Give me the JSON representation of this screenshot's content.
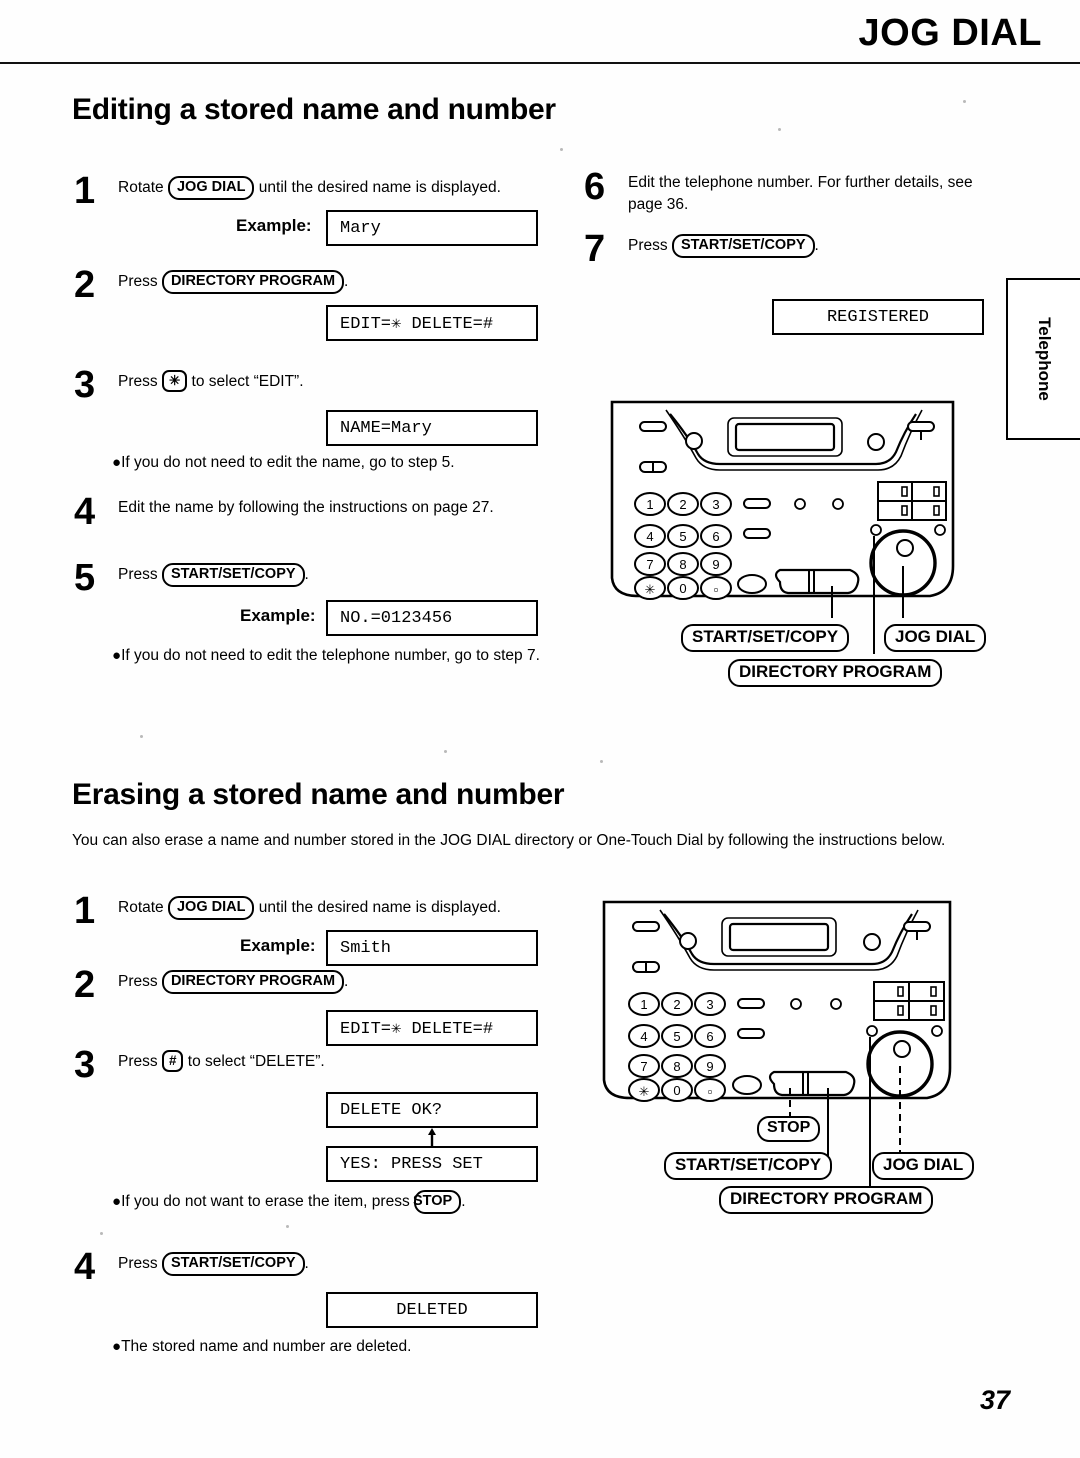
{
  "header": {
    "title": "JOG DIAL"
  },
  "page_number": "37",
  "side_tab": {
    "label": "Telephone"
  },
  "sections": [
    {
      "id": "editing",
      "title": "Editing a stored name and number",
      "steps": [
        {
          "num": "1",
          "text_before": "Rotate ",
          "key": "JOG DIAL",
          "text_after": " until the desired name is displayed.",
          "example_label": "Example:",
          "lcd": "Mary"
        },
        {
          "num": "2",
          "text_before": "Press ",
          "key": "DIRECTORY PROGRAM",
          "text_after": ".",
          "lcd": "EDIT=✳ DELETE=#"
        },
        {
          "num": "3",
          "text_before": "Press ",
          "key": "✳",
          "text_after": " to select “EDIT”.",
          "lcd": "NAME=Mary"
        },
        {
          "num": "4",
          "text_before": "Edit the name by following the instructions on page 27.",
          "key": "",
          "text_after": ""
        },
        {
          "num": "5",
          "text_before": "Press ",
          "key": "START/SET/COPY",
          "text_after": ".",
          "example_label": "Example:",
          "lcd": "NO.=0123456"
        },
        {
          "num": "6",
          "text_before": "Edit the telephone number. For further details, see page 36.",
          "key": "",
          "text_after": ""
        },
        {
          "num": "7",
          "text_before": "Press ",
          "key": "START/SET/COPY",
          "text_after": ".",
          "lcd": "REGISTERED"
        }
      ],
      "notes": [
        {
          "text": "If you do not need to edit the name, go to step 5."
        },
        {
          "text": "If you do not need to edit the telephone number, go to step 7."
        }
      ]
    },
    {
      "id": "erasing",
      "title": "Erasing a stored name and number",
      "intro": "You can also erase a name and number stored in the JOG DIAL directory or One-Touch Dial by following the instructions below.",
      "steps": [
        {
          "num": "1",
          "text_before": "Rotate ",
          "key": "JOG DIAL",
          "text_after": " until the desired name is displayed.",
          "example_label": "Example:",
          "lcd": "Smith"
        },
        {
          "num": "2",
          "text_before": "Press ",
          "key": "DIRECTORY PROGRAM",
          "text_after": ".",
          "lcd": "EDIT=✳ DELETE=#"
        },
        {
          "num": "3",
          "text_before": "Press ",
          "key": "#",
          "text_after": " to select “DELETE”.",
          "lcd": "DELETE OK?",
          "lcd2": "YES: PRESS SET"
        },
        {
          "num": "4",
          "text_before": "Press ",
          "key": "START/SET/COPY",
          "text_after": ".",
          "lcd": "DELETED"
        }
      ],
      "notes": [
        {
          "text_before": "If you do not want to erase the item, press ",
          "key": "STOP",
          "text_after": "."
        },
        {
          "text": "The stored name and number are deleted."
        }
      ]
    }
  ],
  "diagrams": [
    {
      "id": "fax-top",
      "keypad": [
        "1",
        "2",
        "3",
        "4",
        "5",
        "6",
        "7",
        "8",
        "9",
        "✳",
        "0",
        "□"
      ],
      "callouts": [
        {
          "label": "START/SET/COPY"
        },
        {
          "label": "JOG DIAL"
        },
        {
          "label": "DIRECTORY PROGRAM"
        }
      ]
    },
    {
      "id": "fax-bottom",
      "keypad": [
        "1",
        "2",
        "3",
        "4",
        "5",
        "6",
        "7",
        "8",
        "9",
        "✳",
        "0",
        "□"
      ],
      "callouts": [
        {
          "label": "STOP"
        },
        {
          "label": "START/SET/COPY"
        },
        {
          "label": "JOG DIAL"
        },
        {
          "label": "DIRECTORY PROGRAM"
        }
      ]
    }
  ]
}
